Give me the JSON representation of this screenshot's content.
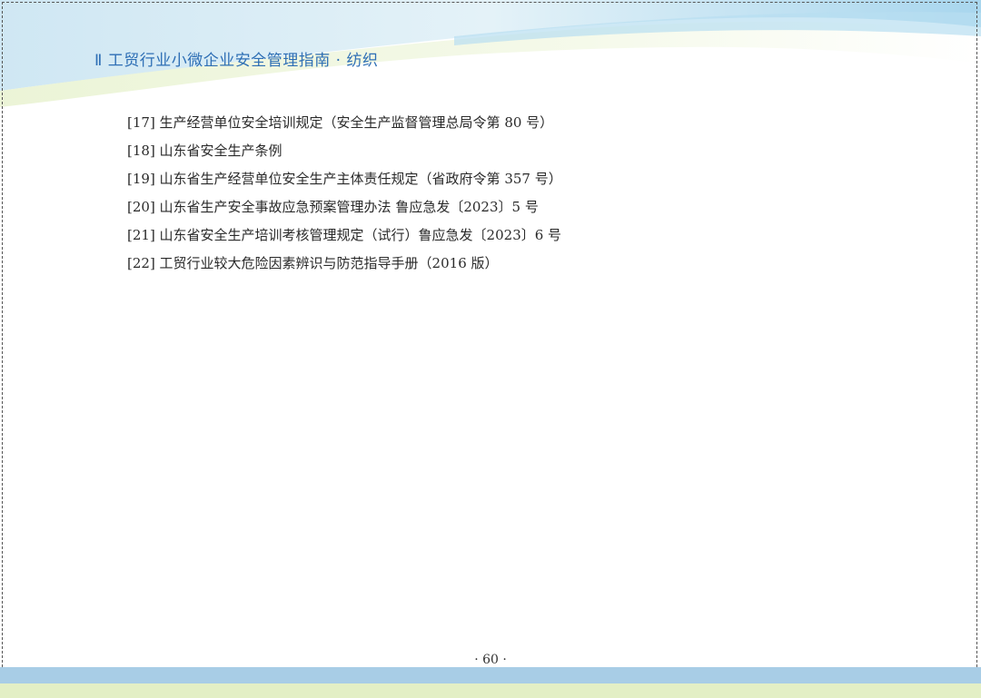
{
  "header": {
    "title": "Ⅱ 工贸行业小微企业安全管理指南  · 纺织"
  },
  "references": [
    {
      "label": "[17] 生产经营单位安全培训规定（安全生产监督管理总局令第 80 号）"
    },
    {
      "label": "[18] 山东省安全生产条例"
    },
    {
      "label": "[19] 山东省生产经营单位安全生产主体责任规定（省政府令第 357 号）"
    },
    {
      "label": "[20] 山东省生产安全事故应急预案管理办法 鲁应急发〔2023〕5 号"
    },
    {
      "label": "[21] 山东省安全生产培训考核管理规定（试行）鲁应急发〔2023〕6 号"
    },
    {
      "label": "[22] 工贸行业较大危险因素辨识与防范指导手册（2016 版）"
    }
  ],
  "footer": {
    "page_number": "· 60 ·"
  },
  "colors": {
    "title": "#2e6fb5",
    "header_wave_light": "#d6ecf5",
    "header_wave_blue": "#a9d6ee",
    "header_wave_green": "#e6f1c6",
    "footer_blue": "#a8cde6",
    "footer_green": "#e3efc5"
  }
}
